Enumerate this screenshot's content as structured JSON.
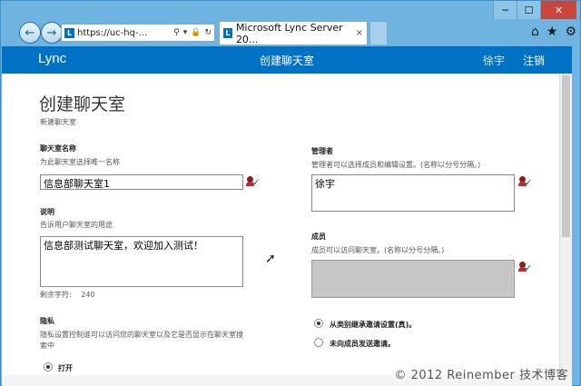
{
  "browser": {
    "address_url": "https://uc-hq-...",
    "tab_title": "Microsoft Lync Server 20...",
    "tab_close": "×",
    "window_controls": {
      "minimize": "─",
      "maximize": "☐",
      "close": "✕"
    },
    "toolbar_icons": {
      "home": "⌂",
      "favorites": "★",
      "settings": "⚙"
    },
    "address_icons": {
      "search": "⚲",
      "dropdown": "▾",
      "lock": "🔒",
      "refresh": "↻"
    }
  },
  "header": {
    "brand": "Lync",
    "title": "创建聊天室",
    "user": "徐宇",
    "signout": "注销",
    "bar_color": "#0072c6"
  },
  "form": {
    "title": "创建聊天室",
    "subtitle": "新建聊天室",
    "room_name": {
      "label": "聊天室名称",
      "hint": "为此聊天室选择唯一名称",
      "value": "信息部聊天室1"
    },
    "description": {
      "label": "说明",
      "hint": "告诉用户聊天室的用途",
      "value": "信息部测试聊天室，欢迎加入测试！",
      "remaining_label": "剩余字符:",
      "remaining_value": "240"
    },
    "privacy": {
      "label": "隐私",
      "hint": "隐私设置控制谁可以访问您的聊天室以及它是否显示在聊天室搜索中",
      "option_open": "打开",
      "open_selected": true
    },
    "managers": {
      "label": "管理者",
      "hint": "管理者可以选择成员和编辑设置。(名称以分号分隔。)",
      "value": "徐宇"
    },
    "members": {
      "label": "成员",
      "hint": "成员可以访问聊天室。(名称以分号分隔。)",
      "value": ""
    },
    "invitations": {
      "option_inherit": "从类别继承邀请设置(真)。",
      "option_none": "未向成员发送邀请。",
      "inherit_selected": true
    }
  },
  "watermark": "© 2012 Reinember 技术博客"
}
